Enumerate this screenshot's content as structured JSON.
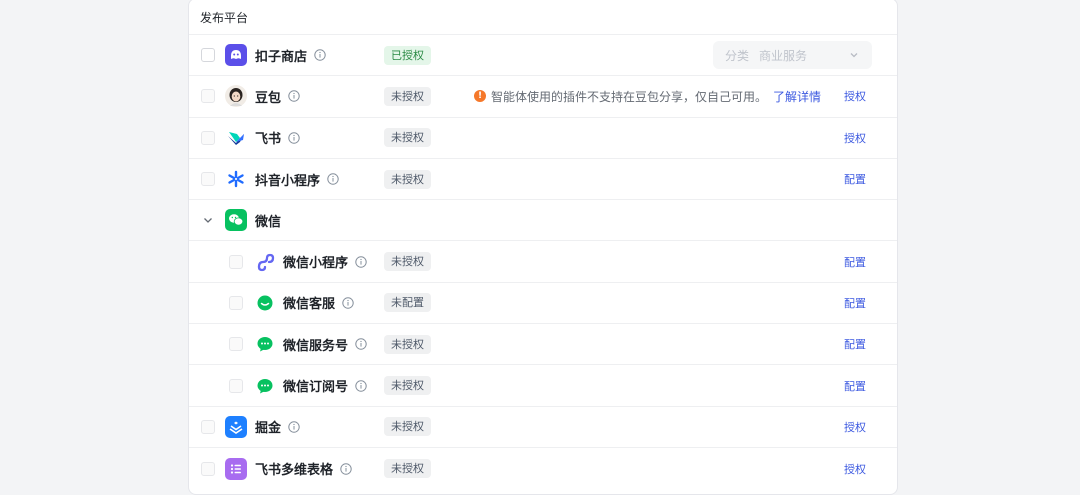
{
  "panel": {
    "title": "发布平台"
  },
  "rows": [
    {
      "name": "扣子商店",
      "status": "已授权",
      "select": {
        "label": "分类",
        "value": "商业服务"
      }
    },
    {
      "name": "豆包",
      "status": "未授权",
      "warning": {
        "text": "智能体使用的插件不支持在豆包分享，仅自己可用。",
        "link": "了解详情"
      },
      "action": "授权"
    },
    {
      "name": "飞书",
      "status": "未授权",
      "action": "授权"
    },
    {
      "name": "抖音小程序",
      "status": "未授权",
      "action": "配置"
    },
    {
      "name": "微信"
    },
    {
      "name": "微信小程序",
      "status": "未授权",
      "action": "配置"
    },
    {
      "name": "微信客服",
      "status": "未配置",
      "action": "配置"
    },
    {
      "name": "微信服务号",
      "status": "未授权",
      "action": "配置"
    },
    {
      "name": "微信订阅号",
      "status": "未授权",
      "action": "配置"
    },
    {
      "name": "掘金",
      "status": "未授权",
      "action": "授权"
    },
    {
      "name": "飞书多维表格",
      "status": "未授权",
      "action": "授权"
    }
  ],
  "icons": {
    "coze_store": "coze-store-icon",
    "doubao": "doubao-avatar-icon",
    "feishu": "feishu-icon",
    "douyin": "douyin-miniapp-icon",
    "wechat": "wechat-icon",
    "wechat_miniprogram": "wechat-miniprogram-icon",
    "wechat_service": "wechat-customer-service-icon",
    "wechat_official": "wechat-official-account-icon",
    "wechat_subscription": "wechat-subscription-icon",
    "juejin": "juejin-icon",
    "feishu_bitable": "feishu-bitable-icon",
    "info": "info-icon",
    "warning": "warning-icon",
    "chevron_down": "chevron-down-icon",
    "collapse": "collapse-chevron-icon"
  },
  "colors": {
    "accent": "#3c59e0",
    "authorized_bg": "#e4f6e9",
    "authorized_text": "#2a8a44",
    "warning": "#f5782a",
    "wechat_green": "#07c160",
    "coze_purple": "#5b4fe9"
  }
}
